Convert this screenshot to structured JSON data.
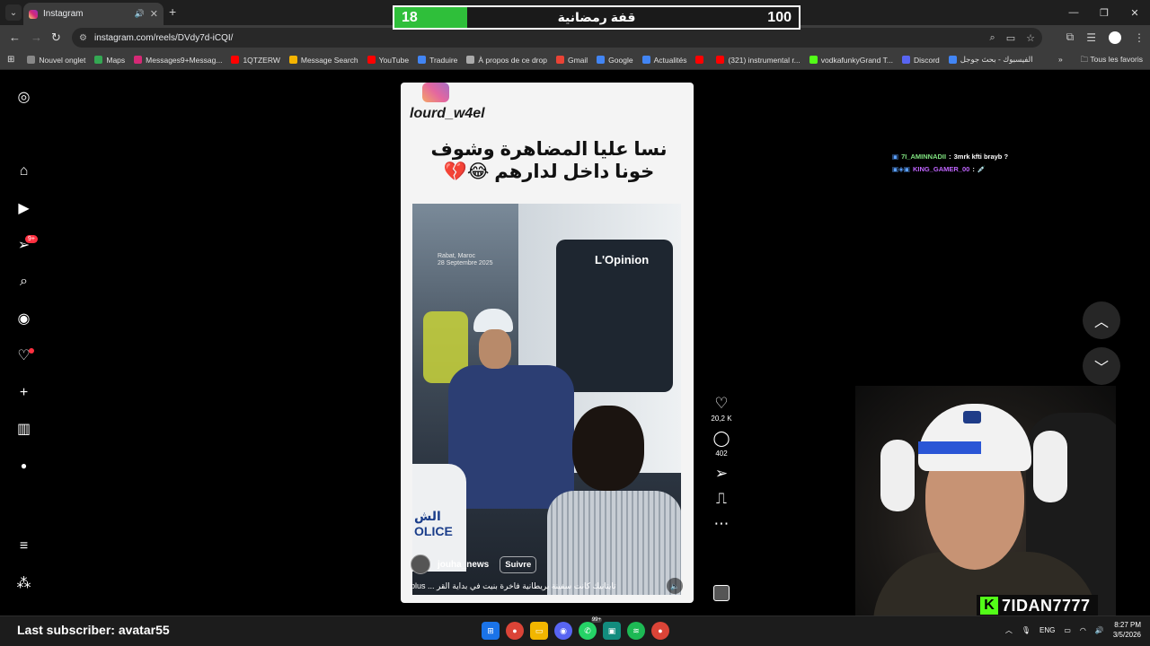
{
  "browser": {
    "tab_title": "Instagram",
    "url": "instagram.com/reels/DVdy7d-iCQI/",
    "window_controls": [
      "—",
      "❐",
      "✕"
    ]
  },
  "score_overlay": {
    "left_value": "18",
    "title": "قفة رمضانية",
    "right_value": "100",
    "progress_fraction": 0.18,
    "fill_color": "#2fbf3a"
  },
  "bookmarks": {
    "items": [
      {
        "label": "Nouvel onglet",
        "icon": "page-icon",
        "color": "#888888"
      },
      {
        "label": "Maps",
        "icon": "maps-icon",
        "color": "#34a853"
      },
      {
        "label": "Messages9+Messag...",
        "icon": "instagram-icon",
        "color": "#d62976"
      },
      {
        "label": "1QTZERW",
        "icon": "youtube-icon",
        "color": "#ff0000"
      },
      {
        "label": "Message Search",
        "icon": "chart-icon",
        "color": "#f4b400"
      },
      {
        "label": "YouTube",
        "icon": "youtube-icon",
        "color": "#ff0000"
      },
      {
        "label": "Traduire",
        "icon": "translate-icon",
        "color": "#4285f4"
      },
      {
        "label": "À propos de ce drop",
        "icon": "globe-icon",
        "color": "#aaaaaa"
      },
      {
        "label": "Gmail",
        "icon": "gmail-icon",
        "color": "#ea4335"
      },
      {
        "label": "Google",
        "icon": "google-icon",
        "color": "#4285f4"
      },
      {
        "label": "Actualités",
        "icon": "news-icon",
        "color": "#4285f4"
      },
      {
        "label": "",
        "icon": "youtube-icon",
        "color": "#ff0000"
      },
      {
        "label": "(321) instrumental r...",
        "icon": "youtube-icon",
        "color": "#ff0000"
      },
      {
        "label": "vodkafunkyGrand T...",
        "icon": "kick-icon",
        "color": "#53fc18"
      },
      {
        "label": "Discord",
        "icon": "discord-icon",
        "color": "#5865f2"
      },
      {
        "label": "الفيسبوك - بحث جوجل",
        "icon": "google-icon",
        "color": "#4285f4"
      }
    ],
    "all_bookmarks_label": "Tous les favoris"
  },
  "reel": {
    "watermark": "lourd_w4el",
    "caption": "نسا عليا المضاهرة وشوف خونا داخل لدارهم 😂💔",
    "video_brand": "L'Opinion",
    "location_line1": "Rabat, Maroc",
    "location_line2": "28 Septembre 2025",
    "vest_text": "OLICE",
    "vest_text_top": "الش",
    "username": "jouha_news",
    "follow_label": "Suivre",
    "description": "تايتانيك كانت سفينة بريطانية فاخرة بنيت في بداية القر ... plus"
  },
  "actions": {
    "likes": "20,2 K",
    "comments": "402"
  },
  "chat": [
    {
      "user": "7I_AMINNADII",
      "message": "3mrk kfti brayb ?"
    },
    {
      "user": "KING_GAMER_00",
      "message": "💉"
    }
  ],
  "stream": {
    "last_subscriber": "Last subscriber: avatar55",
    "kick_name": "7IDAN7777"
  },
  "taskbar": {
    "language": "ENG",
    "time": "8:27 PM",
    "date": "3/5/2026",
    "badge_count": "99+"
  }
}
